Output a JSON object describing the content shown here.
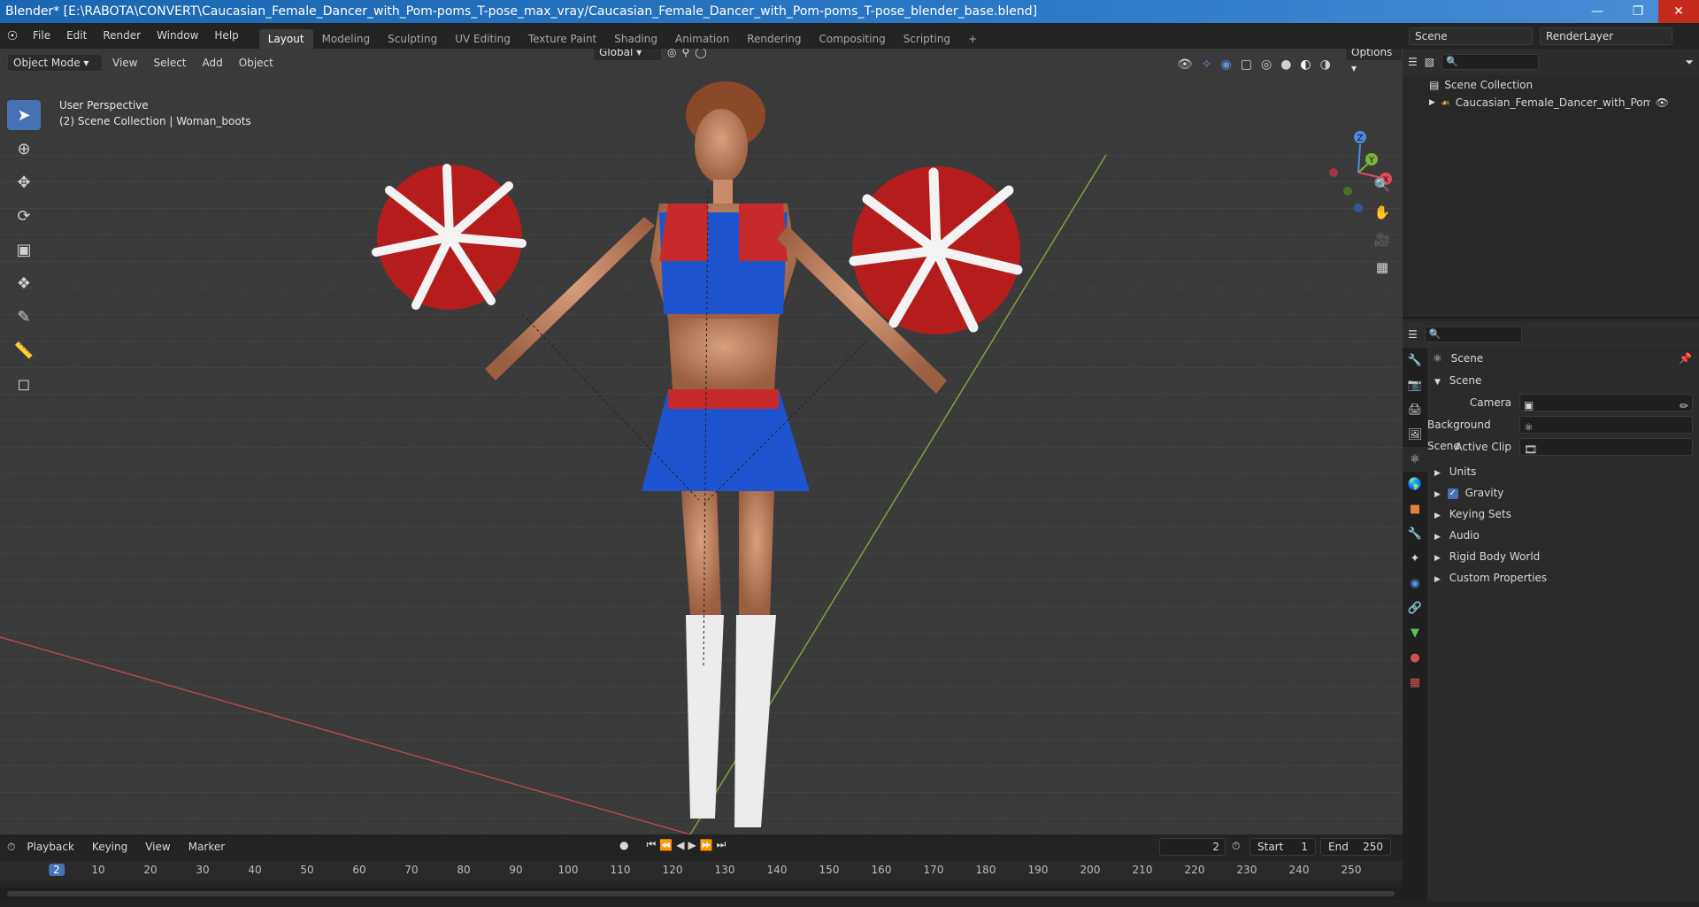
{
  "window": {
    "title": "Blender* [E:\\RABOTA\\CONVERT\\Caucasian_Female_Dancer_with_Pom-poms_T-pose_max_vray/Caucasian_Female_Dancer_with_Pom-poms_T-pose_blender_base.blend]"
  },
  "menu": [
    "File",
    "Edit",
    "Render",
    "Window",
    "Help"
  ],
  "workspaces": [
    "Layout",
    "Modeling",
    "Sculpting",
    "UV Editing",
    "Texture Paint",
    "Shading",
    "Animation",
    "Rendering",
    "Compositing",
    "Scripting"
  ],
  "active_workspace": "Layout",
  "scene_selector": "Scene",
  "render_layer": "RenderLayer",
  "viewport": {
    "mode": "Object Mode",
    "menus": [
      "View",
      "Select",
      "Add",
      "Object"
    ],
    "orientation": "Global",
    "options_label": "Options",
    "overlay_title": "User Perspective",
    "overlay_sub": "(2) Scene Collection | Woman_boots",
    "gizmo_x": "X",
    "gizmo_y": "Y",
    "gizmo_z": "Z"
  },
  "outliner": {
    "root": "Scene Collection",
    "item": "Caucasian_Female_Dancer_with_Pom_poms"
  },
  "properties": {
    "context": "Scene",
    "panel": "Scene",
    "camera_label": "Camera",
    "bg_scene_label": "Background Scene",
    "active_clip_label": "Active Clip",
    "sections": [
      "Units",
      "Gravity",
      "Keying Sets",
      "Audio",
      "Rigid Body World",
      "Custom Properties"
    ]
  },
  "timeline": {
    "menus": [
      "Playback",
      "Keying",
      "View",
      "Marker"
    ],
    "current_frame": "2",
    "start_label": "Start",
    "start_value": "1",
    "end_label": "End",
    "end_value": "250",
    "ticks": [
      "2",
      "10",
      "20",
      "30",
      "40",
      "50",
      "60",
      "70",
      "80",
      "90",
      "100",
      "110",
      "120",
      "130",
      "140",
      "150",
      "160",
      "170",
      "180",
      "190",
      "200",
      "210",
      "220",
      "230",
      "240",
      "250"
    ]
  }
}
